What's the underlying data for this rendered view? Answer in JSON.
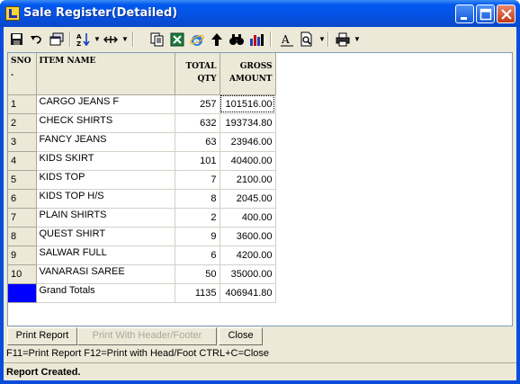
{
  "window": {
    "title": "Sale Register(Detailed)"
  },
  "table": {
    "headers": {
      "sno": [
        "SNO",
        "."
      ],
      "item_name": "ITEM NAME",
      "total_qty": [
        "TOTAL",
        "QTY"
      ],
      "gross_amount": [
        "GROSS",
        "AMOUNT"
      ]
    },
    "rows": [
      {
        "sno": "1",
        "item": "CARGO JEANS F",
        "qty": "257",
        "amount": "101516.00"
      },
      {
        "sno": "2",
        "item": "CHECK SHIRTS",
        "qty": "632",
        "amount": "193734.80"
      },
      {
        "sno": "3",
        "item": "FANCY JEANS",
        "qty": "63",
        "amount": "23946.00"
      },
      {
        "sno": "4",
        "item": "KIDS SKIRT",
        "qty": "101",
        "amount": "40400.00"
      },
      {
        "sno": "5",
        "item": "KIDS TOP",
        "qty": "7",
        "amount": "2100.00"
      },
      {
        "sno": "6",
        "item": "KIDS TOP H/S",
        "qty": "8",
        "amount": "2045.00"
      },
      {
        "sno": "7",
        "item": "PLAIN SHIRTS",
        "qty": "2",
        "amount": "400.00"
      },
      {
        "sno": "8",
        "item": "QUEST SHIRT",
        "qty": "9",
        "amount": "3600.00"
      },
      {
        "sno": "9",
        "item": "SALWAR FULL",
        "qty": "6",
        "amount": "4200.00"
      },
      {
        "sno": "10",
        "item": "VANARASI SAREE",
        "qty": "50",
        "amount": "35000.00"
      }
    ],
    "totals": {
      "label": "Grand Totals",
      "qty": "1135",
      "amount": "406941.80"
    }
  },
  "buttons": {
    "print_report": "Print Report",
    "print_header_footer": "Print With Header/Footer",
    "close": "Close"
  },
  "hint": "F11=Print Report  F12=Print with Head/Foot  CTRL+C=Close",
  "status": "Report Created.",
  "toolbar_icons": [
    "save-icon",
    "undo-icon",
    "copy-window-icon",
    "sort-az-icon",
    "column-width-icon",
    "copy-icon",
    "excel-icon",
    "internet-explorer-icon",
    "up-arrow-icon",
    "find-icon",
    "chart-icon",
    "font-icon",
    "print-preview-icon",
    "printer-icon"
  ],
  "colors": {
    "title_bar": "#0058EE",
    "client": "#ECE9D8",
    "totals_marker": "#0000FF"
  }
}
